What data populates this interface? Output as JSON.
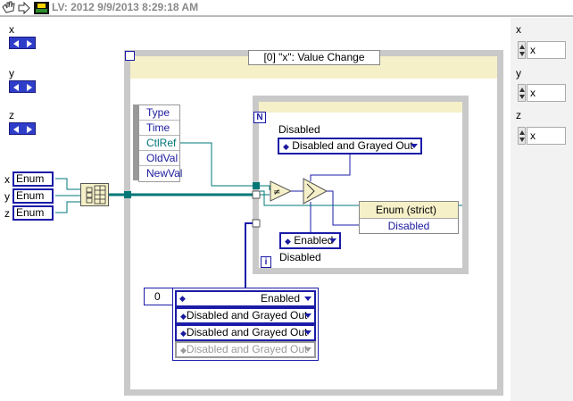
{
  "window": {
    "title": "LV: 2012 9/9/2013 8:29:18 AM"
  },
  "front_controls": {
    "x_label": "x",
    "y_label": "y",
    "z_label": "z"
  },
  "right_controls": [
    {
      "label": "x",
      "value": "x"
    },
    {
      "label": "y",
      "value": "x"
    },
    {
      "label": "z",
      "value": "x"
    }
  ],
  "enum_terminals": [
    {
      "side": "x",
      "label": "Enum"
    },
    {
      "side": "y",
      "label": "Enum"
    },
    {
      "side": "z",
      "label": "Enum"
    }
  ],
  "event_structure": {
    "selector": "[0] \"x\": Value Change",
    "node_items": [
      "Type",
      "Time",
      "CtlRef",
      "OldVal",
      "NewVal"
    ]
  },
  "inner": {
    "n_label": "N",
    "i_label": "i",
    "disabled_label_top": "Disabled",
    "disabled_ring": "Disabled and Grayed Out",
    "enabled_ring": "Enabled",
    "disabled_label_bottom": "Disabled",
    "property_node": {
      "class": "Enum (strict)",
      "property": "Disabled"
    }
  },
  "array": {
    "index": "0",
    "elements": [
      "Enabled",
      "Disabled and Grayed Out",
      "Disabled and Grayed Out",
      "Disabled and Grayed Out"
    ]
  },
  "colors": {
    "wire_teal": "#007777",
    "wire_blue": "#1b1ba8",
    "struct_gray": "#c9c9c9"
  }
}
